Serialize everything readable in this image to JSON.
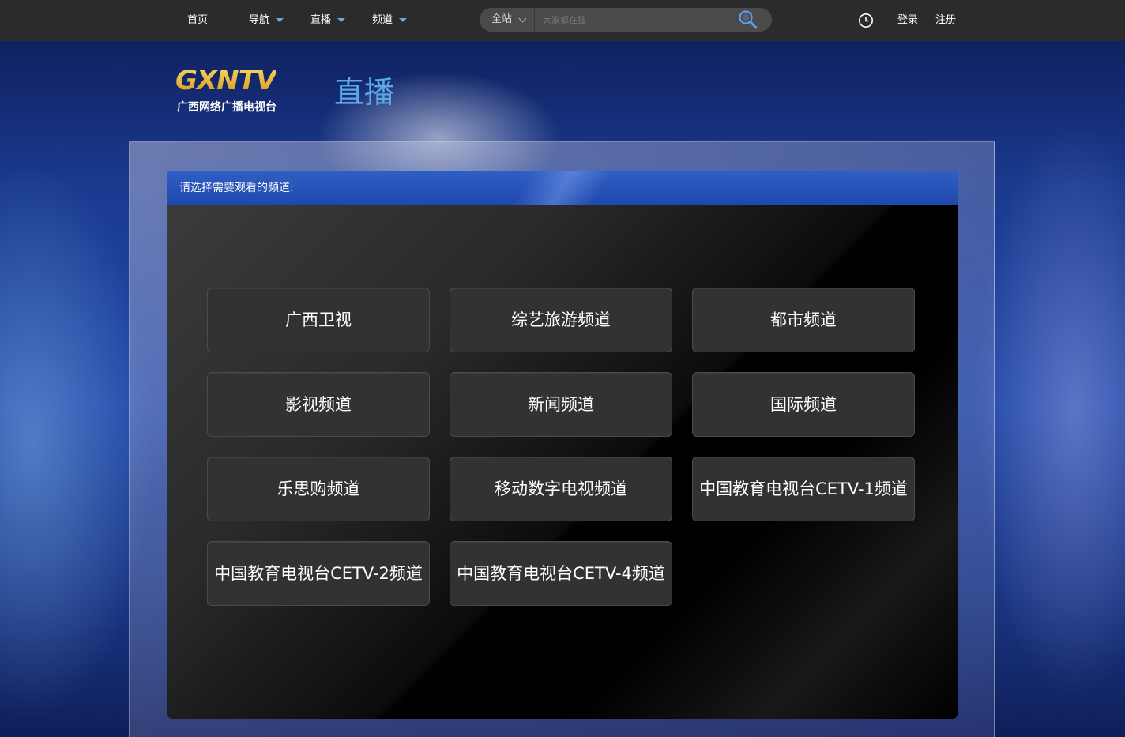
{
  "topbar": {
    "nav": [
      {
        "label": "首页",
        "has_dropdown": false
      },
      {
        "label": "导航",
        "has_dropdown": true
      },
      {
        "label": "直播",
        "has_dropdown": true
      },
      {
        "label": "频道",
        "has_dropdown": true
      }
    ],
    "search": {
      "scope": "全站",
      "placeholder": "大家都在搜",
      "icon": "search-icon"
    },
    "history_icon": "clock-icon",
    "login": "登录",
    "register": "注册"
  },
  "header": {
    "logo_text": "GXNTV",
    "logo_subtitle": "广西网络广播电视台",
    "page_title": "直播"
  },
  "panel": {
    "prompt": "请选择需要观看的频道:",
    "channels": [
      "广西卫视",
      "综艺旅游频道",
      "都市频道",
      "影视频道",
      "新闻频道",
      "国际频道",
      "乐思购频道",
      "移动数字电视频道",
      "中国教育电视台CETV-1频道",
      "中国教育电视台CETV-2频道",
      "中国教育电视台CETV-4频道"
    ]
  },
  "colors": {
    "topbar_bg": "#2b2b2b",
    "accent_blue": "#5aa9e6",
    "panel_header": "#2a56bc",
    "logo_gold": "#e6b327",
    "button_bg": "#323232"
  }
}
